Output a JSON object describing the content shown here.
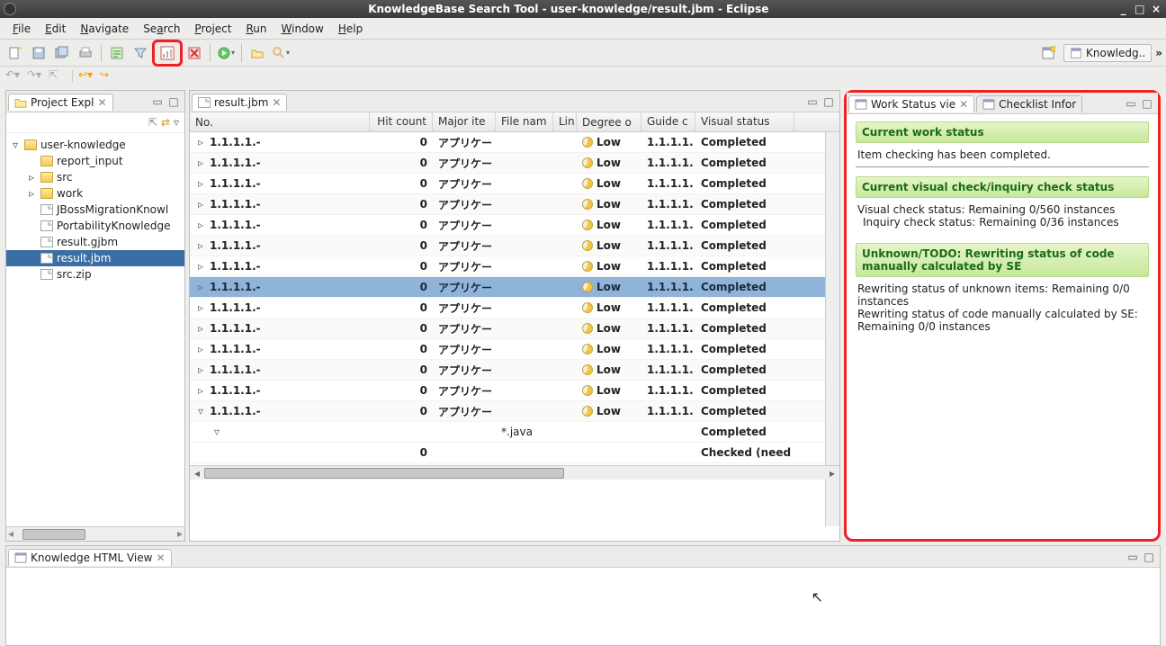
{
  "window": {
    "title": "KnowledgeBase Search Tool - user-knowledge/result.jbm - Eclipse",
    "min": "_",
    "max": "□",
    "close": "×"
  },
  "menu": [
    "File",
    "Edit",
    "Navigate",
    "Search",
    "Project",
    "Run",
    "Window",
    "Help"
  ],
  "perspective": {
    "label": "Knowledg..",
    "overflow": "»"
  },
  "projectExplorer": {
    "tab": "Project Expl",
    "items": [
      {
        "indent": 0,
        "toggle": "▿",
        "icon": "folder",
        "label": "user-knowledge"
      },
      {
        "indent": 1,
        "toggle": "",
        "icon": "folder",
        "label": "report_input"
      },
      {
        "indent": 1,
        "toggle": "▹",
        "icon": "folder",
        "label": "src"
      },
      {
        "indent": 1,
        "toggle": "▹",
        "icon": "folder",
        "label": "work"
      },
      {
        "indent": 1,
        "toggle": "",
        "icon": "file",
        "label": "JBossMigrationKnowl"
      },
      {
        "indent": 1,
        "toggle": "",
        "icon": "file",
        "label": "PortabilityKnowledge"
      },
      {
        "indent": 1,
        "toggle": "",
        "icon": "file",
        "label": "result.gjbm"
      },
      {
        "indent": 1,
        "toggle": "",
        "icon": "file",
        "label": "result.jbm",
        "selected": true
      },
      {
        "indent": 1,
        "toggle": "",
        "icon": "file",
        "label": "src.zip"
      }
    ]
  },
  "editor": {
    "tab": "result.jbm",
    "columns": [
      "No.",
      "Hit count",
      "Major ite",
      "File nam",
      "Lin",
      "Degree o",
      "Guide c",
      "Visual status"
    ],
    "rows": [
      {
        "no": "1.1.1.1.-",
        "hit": "0",
        "major": "アプリケー",
        "deg": "Low",
        "guide": "1.1.1.1.",
        "vis": "Completed",
        "exp": "▹"
      },
      {
        "no": "1.1.1.1.-",
        "hit": "0",
        "major": "アプリケー",
        "deg": "Low",
        "guide": "1.1.1.1.",
        "vis": "Completed",
        "exp": "▹"
      },
      {
        "no": "1.1.1.1.-",
        "hit": "0",
        "major": "アプリケー",
        "deg": "Low",
        "guide": "1.1.1.1.",
        "vis": "Completed",
        "exp": "▹"
      },
      {
        "no": "1.1.1.1.-",
        "hit": "0",
        "major": "アプリケー",
        "deg": "Low",
        "guide": "1.1.1.1.",
        "vis": "Completed",
        "exp": "▹"
      },
      {
        "no": "1.1.1.1.-",
        "hit": "0",
        "major": "アプリケー",
        "deg": "Low",
        "guide": "1.1.1.1.",
        "vis": "Completed",
        "exp": "▹"
      },
      {
        "no": "1.1.1.1.-",
        "hit": "0",
        "major": "アプリケー",
        "deg": "Low",
        "guide": "1.1.1.1.",
        "vis": "Completed",
        "exp": "▹"
      },
      {
        "no": "1.1.1.1.-",
        "hit": "0",
        "major": "アプリケー",
        "deg": "Low",
        "guide": "1.1.1.1.",
        "vis": "Completed",
        "exp": "▹"
      },
      {
        "no": "1.1.1.1.-",
        "hit": "0",
        "major": "アプリケー",
        "deg": "Low",
        "guide": "1.1.1.1.",
        "vis": "Completed",
        "exp": "▹",
        "sel": true
      },
      {
        "no": "1.1.1.1.-",
        "hit": "0",
        "major": "アプリケー",
        "deg": "Low",
        "guide": "1.1.1.1.",
        "vis": "Completed",
        "exp": "▹"
      },
      {
        "no": "1.1.1.1.-",
        "hit": "0",
        "major": "アプリケー",
        "deg": "Low",
        "guide": "1.1.1.1.",
        "vis": "Completed",
        "exp": "▹"
      },
      {
        "no": "1.1.1.1.-",
        "hit": "0",
        "major": "アプリケー",
        "deg": "Low",
        "guide": "1.1.1.1.",
        "vis": "Completed",
        "exp": "▹"
      },
      {
        "no": "1.1.1.1.-",
        "hit": "0",
        "major": "アプリケー",
        "deg": "Low",
        "guide": "1.1.1.1.",
        "vis": "Completed",
        "exp": "▹"
      },
      {
        "no": "1.1.1.1.-",
        "hit": "0",
        "major": "アプリケー",
        "deg": "Low",
        "guide": "1.1.1.1.",
        "vis": "Completed",
        "exp": "▹"
      },
      {
        "no": "1.1.1.1.-",
        "hit": "0",
        "major": "アプリケー",
        "deg": "Low",
        "guide": "1.1.1.1.",
        "vis": "Completed",
        "exp": "▿"
      }
    ],
    "subrows": [
      {
        "indent": 1,
        "exp": "▿",
        "file": "*.java",
        "vis": "Completed"
      },
      {
        "indent": 2,
        "hit": "0",
        "vis": "Checked (need to b"
      }
    ]
  },
  "workStatus": {
    "tab1": "Work Status vie",
    "tab2": "Checklist Infor",
    "h1": "Current work status",
    "t1": "Item checking has been completed.",
    "h2": "Current visual check/inquiry check status",
    "t2a": "Visual check status: Remaining 0/560 instances",
    "t2b": "Inquiry check status: Remaining 0/36 instances",
    "h3": "Unknown/TODO: Rewriting status of code manually calculated by SE",
    "t3a": "Rewriting status of unknown items: Remaining 0/0 instances",
    "t3b": "Rewriting status of code manually calculated by SE: Remaining 0/0 instances"
  },
  "bottomView": {
    "tab": "Knowledge HTML View"
  }
}
